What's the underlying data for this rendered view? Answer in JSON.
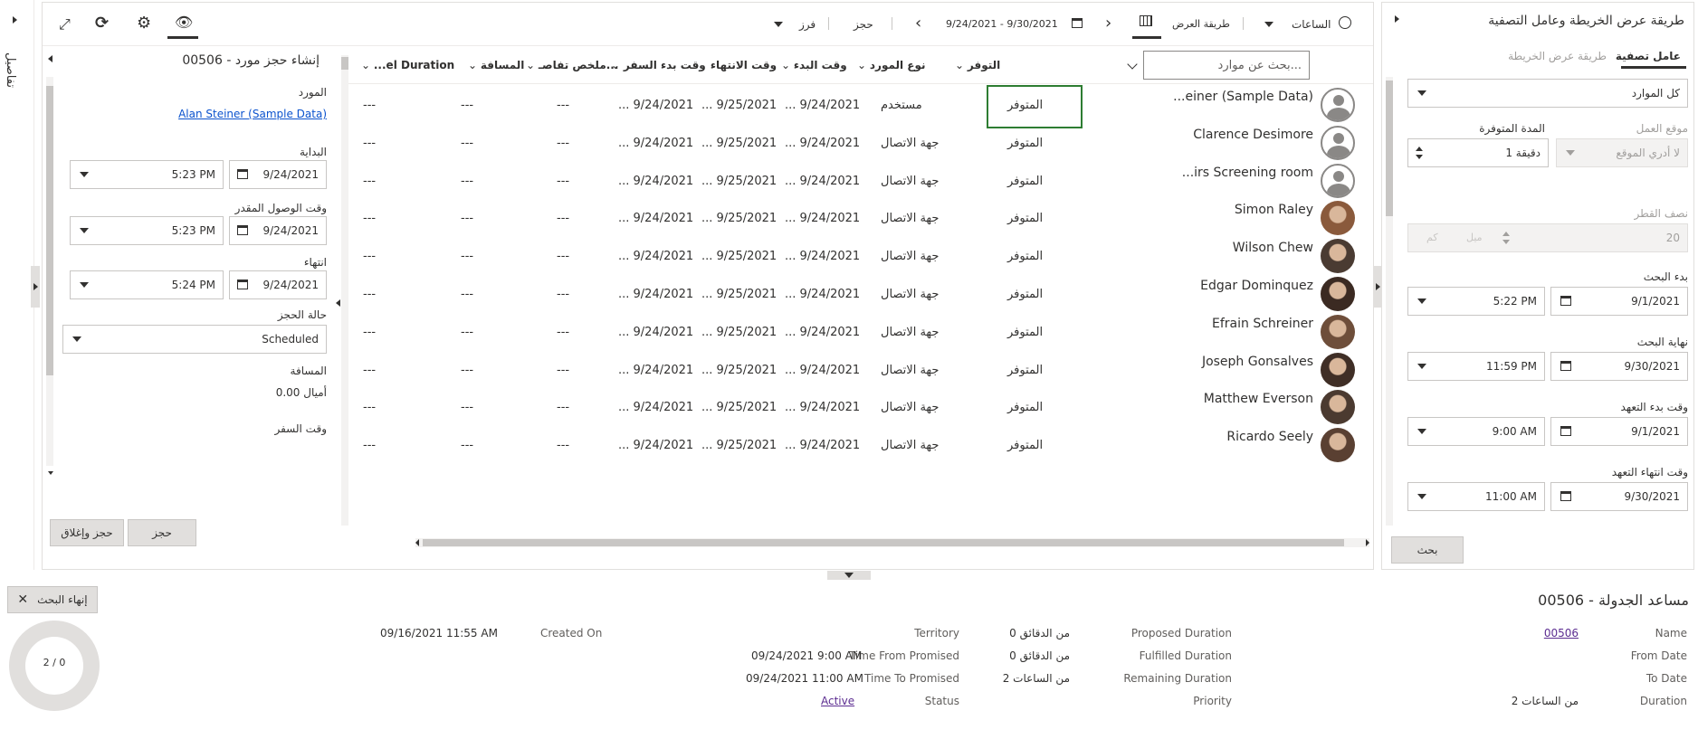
{
  "top": {
    "title_left_panel": "طريقة عرض الخريطة وعامل التصفية",
    "tab_filter": "عامل تصفية",
    "tab_map": "طريقة عرض الخريطة",
    "hours_label": "الساعات",
    "view_type_label": "طريقة العرض",
    "date_range": "9/24/2021 - 9/30/2021",
    "book_label": "حجز",
    "sort_label": "فرز",
    "details_vertical": "تفاصيل"
  },
  "filter": {
    "resources_select": "كل الموارد",
    "work_location_label": "موقع العمل",
    "work_location_value": "لا أدري الموقع",
    "available_duration_label": "المدة المتوفرة",
    "available_duration_value": "1 دقيقة",
    "radius_label": "نصف القطر",
    "radius_value": "20",
    "radius_unit1": "ميل",
    "radius_unit2": "كم",
    "search_start_label": "بدء البحث",
    "search_start_date": "9/1/2021",
    "search_start_time": "5:22 PM",
    "search_end_label": "نهاية البحث",
    "search_end_date": "9/30/2021",
    "search_end_time": "11:59 PM",
    "promise_start_label": "وقت بدء التعهد",
    "promise_start_date": "9/1/2021",
    "promise_start_time": "9:00 AM",
    "promise_end_label": "وقت انتهاء التعهد",
    "promise_end_date": "9/30/2021",
    "promise_end_time": "11:00 AM",
    "search_button": "بحث"
  },
  "grid": {
    "search_placeholder": "بحث عن موارد...",
    "headers": [
      "التوفر",
      "نوع المورد",
      "وقت البدء",
      "وقت الانتهاء",
      "وقت بدء السفر",
      "ملخص تفاصـ...",
      "المسافة",
      "...el Duration"
    ],
    "rows": [
      {
        "name": "...einer (Sample Data)",
        "avail": "المتوفر",
        "type": "مستخدم",
        "start": "... 9/24/2021",
        "end": "... 9/25/2021",
        "travel": "... 9/24/2021",
        "summary": "---",
        "distance": "---",
        "duration": "---"
      },
      {
        "name": "Clarence Desimore",
        "avail": "المتوفر",
        "type": "جهة الاتصال",
        "start": "... 9/24/2021",
        "end": "... 9/25/2021",
        "travel": "... 9/24/2021",
        "summary": "---",
        "distance": "---",
        "duration": "---"
      },
      {
        "name": "...irs Screening room",
        "avail": "المتوفر",
        "type": "جهة الاتصال",
        "start": "... 9/24/2021",
        "end": "... 9/25/2021",
        "travel": "... 9/24/2021",
        "summary": "---",
        "distance": "---",
        "duration": "---"
      },
      {
        "name": "Simon Raley",
        "avail": "المتوفر",
        "type": "جهة الاتصال",
        "start": "... 9/24/2021",
        "end": "... 9/25/2021",
        "travel": "... 9/24/2021",
        "summary": "---",
        "distance": "---",
        "duration": "---"
      },
      {
        "name": "Wilson Chew",
        "avail": "المتوفر",
        "type": "جهة الاتصال",
        "start": "... 9/24/2021",
        "end": "... 9/25/2021",
        "travel": "... 9/24/2021",
        "summary": "---",
        "distance": "---",
        "duration": "---"
      },
      {
        "name": "Edgar Dominquez",
        "avail": "المتوفر",
        "type": "جهة الاتصال",
        "start": "... 9/24/2021",
        "end": "... 9/25/2021",
        "travel": "... 9/24/2021",
        "summary": "---",
        "distance": "---",
        "duration": "---"
      },
      {
        "name": "Efrain Schreiner",
        "avail": "المتوفر",
        "type": "جهة الاتصال",
        "start": "... 9/24/2021",
        "end": "... 9/25/2021",
        "travel": "... 9/24/2021",
        "summary": "---",
        "distance": "---",
        "duration": "---"
      },
      {
        "name": "Joseph Gonsalves",
        "avail": "المتوفر",
        "type": "جهة الاتصال",
        "start": "... 9/24/2021",
        "end": "... 9/25/2021",
        "travel": "... 9/24/2021",
        "summary": "---",
        "distance": "---",
        "duration": "---"
      },
      {
        "name": "Matthew Everson",
        "avail": "المتوفر",
        "type": "جهة الاتصال",
        "start": "... 9/24/2021",
        "end": "... 9/25/2021",
        "travel": "... 9/24/2021",
        "summary": "---",
        "distance": "---",
        "duration": "---"
      },
      {
        "name": "Ricardo Seely",
        "avail": "المتوفر",
        "type": "جهة الاتصال",
        "start": "... 9/24/2021",
        "end": "... 9/25/2021",
        "travel": "... 9/24/2021",
        "summary": "---",
        "distance": "---",
        "duration": "---"
      }
    ]
  },
  "booking": {
    "title": "إنشاء حجز مورد - 00506",
    "resource_label": "المورد",
    "resource_value": "Alan Steiner (Sample Data)",
    "start_label": "البداية",
    "start_date": "9/24/2021",
    "start_time": "5:23 PM",
    "arrival_label": "وقت الوصول المقدر",
    "arrival_date": "9/24/2021",
    "arrival_time": "5:23 PM",
    "end_label": "انتهاء",
    "end_date": "9/24/2021",
    "end_time": "5:24 PM",
    "status_label": "حالة الحجز",
    "status_value": "Scheduled",
    "distance_label": "المسافة",
    "distance_value": "0.00 أميال",
    "travel_label": "وقت السفر",
    "book_button": "حجز",
    "book_close_button": "حجز وإغلاق"
  },
  "bottom": {
    "title": "مساعد الجدولة - 00506",
    "end_search_button": "إنهاء البحث",
    "progress_text": "2 / 0",
    "fields": {
      "name_label": "Name",
      "name_value": "00506",
      "from_date_label": "From Date",
      "to_date_label": "To Date",
      "duration_label": "Duration",
      "duration_value": "2 من الساعات",
      "proposed_label": "Proposed Duration",
      "proposed_value": "0 من الدقائق",
      "fulfilled_label": "Fulfilled Duration",
      "fulfilled_value": "0 من الدقائق",
      "remaining_label": "Remaining Duration",
      "remaining_value": "2 من الساعات",
      "priority_label": "Priority",
      "territory_label": "Territory",
      "time_from_label": "Time From Promised",
      "time_from_value": "09/24/2021 9:00 AM",
      "time_to_label": "Time To Promised",
      "time_to_value": "09/24/2021 11:00 AM",
      "status_label": "Status",
      "status_value": "Active",
      "created_label": "Created On",
      "created_value": "09/16/2021 11:55 AM"
    }
  }
}
